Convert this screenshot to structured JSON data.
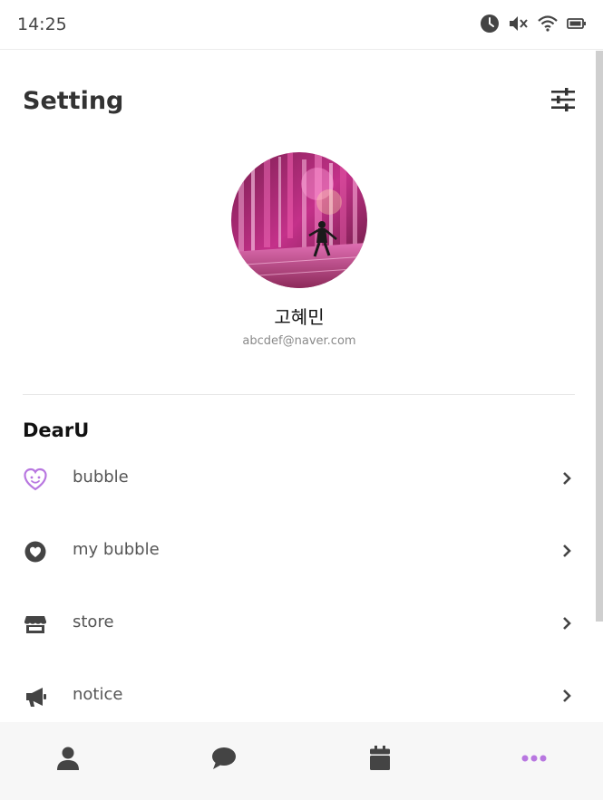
{
  "status_bar": {
    "time": "14:25",
    "icons": [
      "clock-icon",
      "mute-icon",
      "wifi-icon",
      "battery-icon"
    ]
  },
  "header": {
    "title": "Setting",
    "filter_icon": "sliders-icon"
  },
  "profile": {
    "name": "고혜민",
    "email": "abcdef@naver.com"
  },
  "section": {
    "title": "DearU",
    "items": [
      {
        "label": "bubble",
        "icon": "bubble-heart-face-icon"
      },
      {
        "label": "my bubble",
        "icon": "heart-circle-icon"
      },
      {
        "label": "store",
        "icon": "store-icon"
      },
      {
        "label": "notice",
        "icon": "megaphone-icon"
      }
    ]
  },
  "bottom_nav": {
    "items": [
      "person-icon",
      "chat-icon",
      "calendar-icon",
      "more-icon"
    ],
    "active": "more-icon"
  },
  "colors": {
    "accent": "#b877e0",
    "icon": "#444444",
    "nav_background": "#f7f7f7"
  }
}
